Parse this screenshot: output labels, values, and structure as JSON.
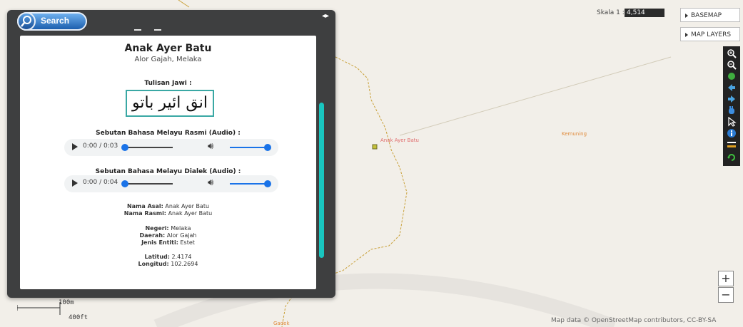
{
  "search": {
    "label": "Search"
  },
  "place": {
    "name": "Anak Ayer Batu",
    "subtitle": "Alor Gajah, Melaka",
    "jawi_label": "Tulisan Jawi :",
    "jawi_text": "انق ائير باتو",
    "audio_rasmi_label": "Sebutan Bahasa Melayu Rasmi (Audio) :",
    "audio_rasmi_time": "0:00 / 0:03",
    "audio_dialek_label": "Sebutan Bahasa Melayu Dialek (Audio) :",
    "audio_dialek_time": "0:00 / 0:04",
    "attributes": {
      "nama_asal_label": "Nama Asal:",
      "nama_asal": "Anak Ayer Batu",
      "nama_rasmi_label": "Nama Rasmi:",
      "nama_rasmi": "Anak Ayer Batu",
      "negeri_label": "Negeri:",
      "negeri": "Melaka",
      "daerah_label": "Daerah:",
      "daerah": "Alor Gajah",
      "jenis_label": "Jenis Entiti:",
      "jenis": "Estet",
      "latitud_label": "Latitud:",
      "latitud": "2.4174",
      "longitud_label": "Longitud:",
      "longitud": "102.2694"
    }
  },
  "map": {
    "scale_label": "Skala 1 :",
    "scale_value": "4,514",
    "basemap_label": "BASEMAP",
    "layers_label": "MAP LAYERS",
    "labels": {
      "kemuning": "Kemuning",
      "anak_ayer_batu": "Anak Ayer Batu",
      "gadek": "Gadek"
    },
    "attribution": "Map data © OpenStreetMap contributors, CC-BY-SA",
    "scalebar_m": "100m",
    "scalebar_ft": "400ft",
    "zoom_in": "+",
    "zoom_out": "−"
  },
  "tools": [
    "zoom-in-icon",
    "zoom-out-icon",
    "globe-icon",
    "pan-left-icon",
    "pan-right-icon",
    "hand-icon",
    "pointer-icon",
    "info-icon",
    "measure-icon",
    "refresh-icon"
  ],
  "colors": {
    "panel_bg": "#3e3f40",
    "accent_teal": "#19c6c0",
    "map_bg": "#f2efe9",
    "road": "#c9a13a",
    "poi_label": "#e06b6b"
  }
}
